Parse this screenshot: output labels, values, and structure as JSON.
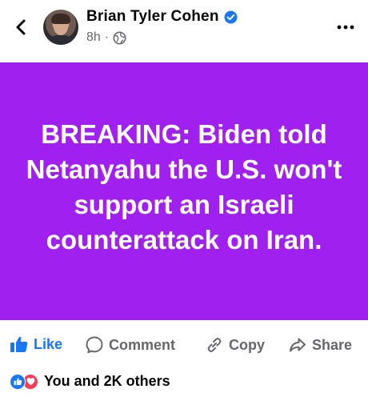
{
  "header": {
    "author_name": "Brian Tyler Cohen",
    "time_ago": "8h",
    "separator": "·",
    "icons": {
      "back": "chevron-left-icon",
      "verified": "verified-badge-icon",
      "audience": "globe-icon",
      "more": "more-dots-icon"
    }
  },
  "post": {
    "text": "BREAKING: Biden told Netanyahu the U.S. won't support an Israeli counterattack on Iran.",
    "background_color": "#a020f0"
  },
  "actions": {
    "like_label": "Like",
    "comment_label": "Comment",
    "copy_label": "Copy",
    "share_label": "Share",
    "like_color": "#1877f2"
  },
  "reactions": {
    "summary": "You and 2K others",
    "types": [
      "like",
      "love"
    ]
  }
}
